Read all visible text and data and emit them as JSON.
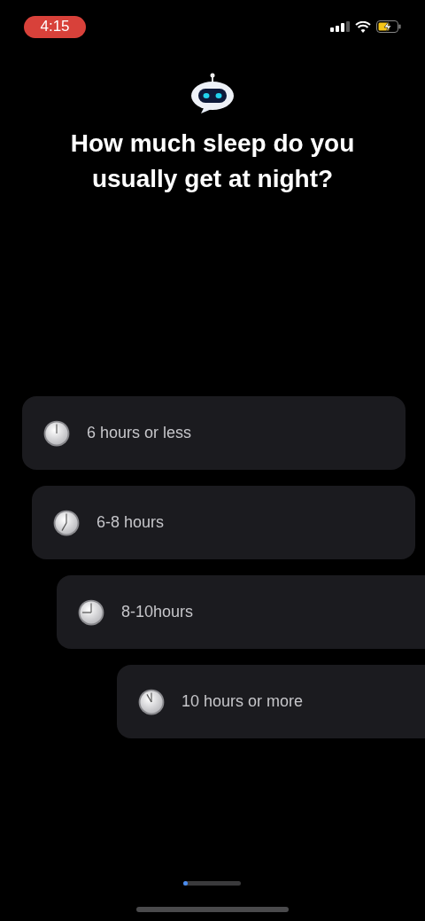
{
  "status_bar": {
    "time": "4:15"
  },
  "question": "How much sleep do you usually get at night?",
  "options": [
    {
      "label": "6 hours or less"
    },
    {
      "label": "6-8 hours"
    },
    {
      "label": "8-10hours"
    },
    {
      "label": "10 hours or more"
    }
  ],
  "progress": {
    "level": 0.08
  }
}
